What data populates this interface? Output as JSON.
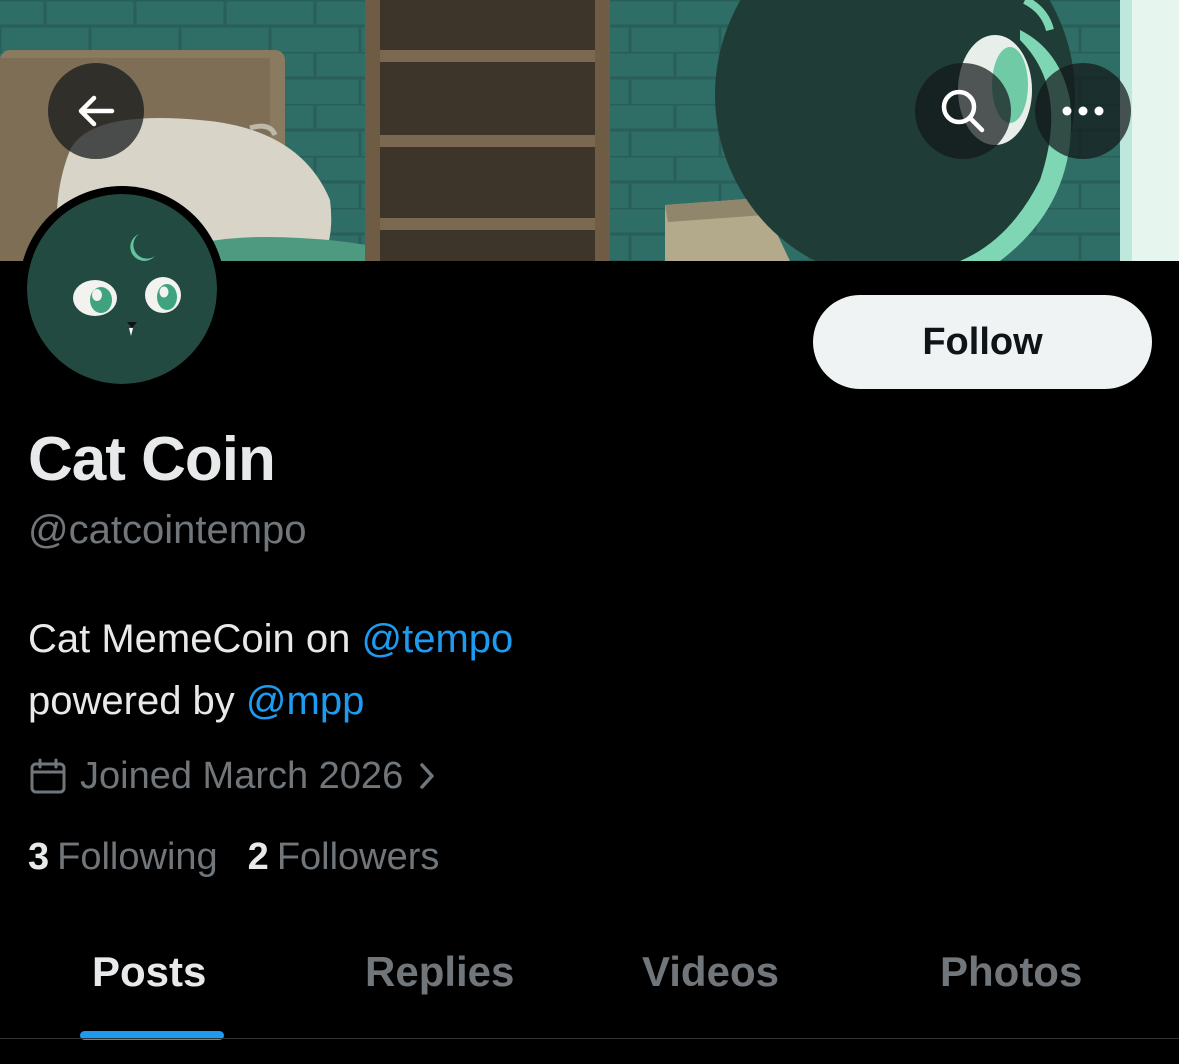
{
  "header": {
    "back_icon": "arrow-left-icon",
    "search_icon": "search-icon",
    "more_icon": "more-horizontal-icon"
  },
  "profile": {
    "display_name": "Cat Coin",
    "handle": "@catcointempo",
    "follow_label": "Follow",
    "bio": {
      "line1_text": "Cat MemeCoin on ",
      "line1_mention": "@tempo",
      "line2_text": "powered by ",
      "line2_mention": "@mpp"
    },
    "joined": "Joined March 2026",
    "following_count": "3",
    "following_label": "Following",
    "followers_count": "2",
    "followers_label": "Followers"
  },
  "tabs": [
    {
      "label": "Posts",
      "active": true
    },
    {
      "label": "Replies",
      "active": false
    },
    {
      "label": "Videos",
      "active": false
    },
    {
      "label": "Photos",
      "active": false
    }
  ],
  "colors": {
    "background": "#000000",
    "accent": "#1d9bf0",
    "primary_text": "#e7e9ea",
    "secondary_text": "#71767b",
    "follow_button_bg": "#eff3f4"
  }
}
